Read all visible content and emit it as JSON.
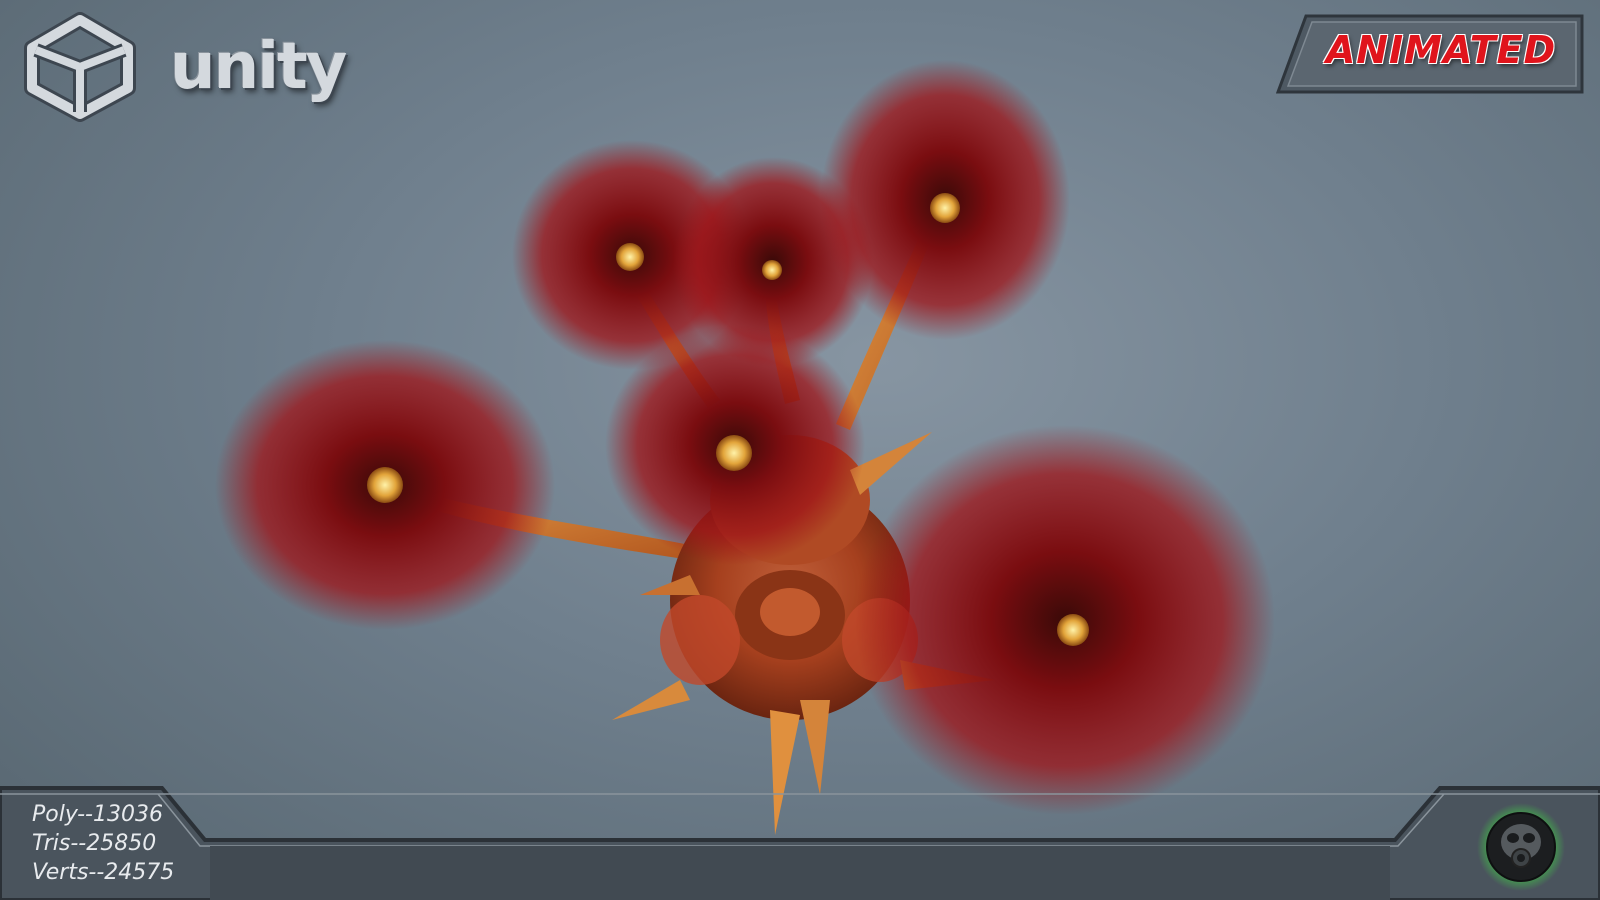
{
  "logo": {
    "text": "unity",
    "icon": "unity-cube-icon"
  },
  "badge": {
    "label": "ANIMATED",
    "color": "#e0141c"
  },
  "stats": {
    "poly": "Poly--13036",
    "tris": "Tris--25850",
    "verts": "Verts--24575"
  },
  "brand": {
    "icon": "gas-mask-icon",
    "glow_color": "#3cff3c"
  }
}
